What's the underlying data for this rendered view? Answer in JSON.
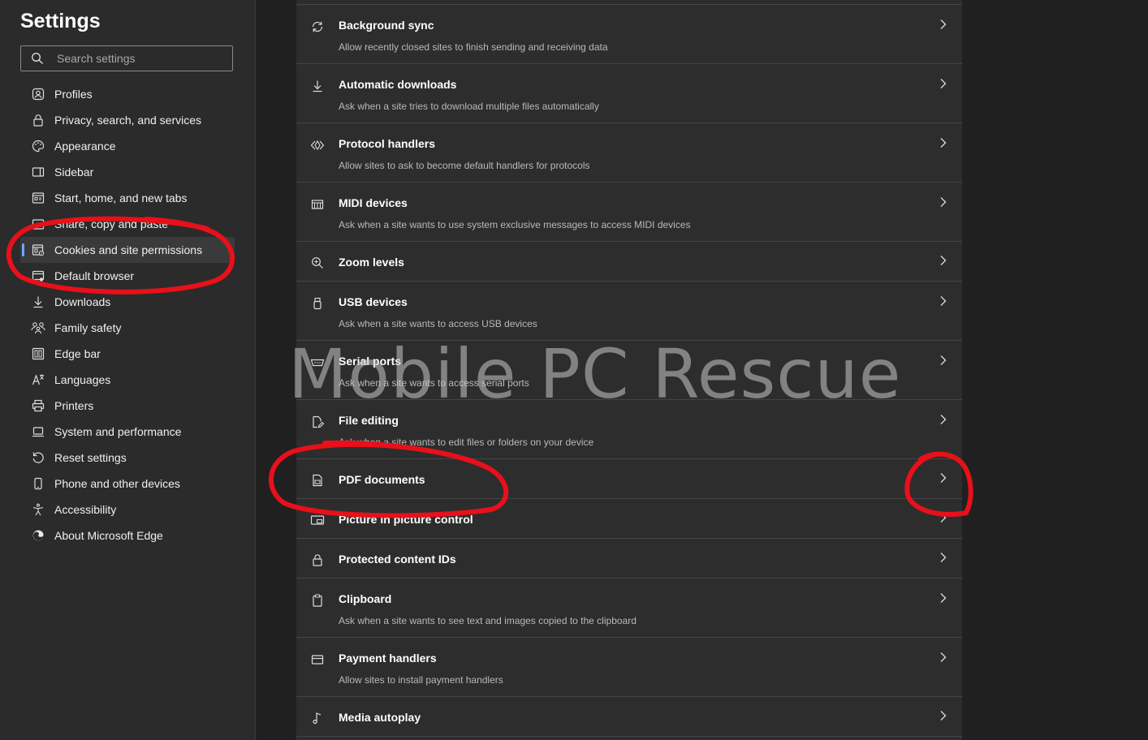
{
  "sidebar": {
    "title": "Settings",
    "search_placeholder": "Search settings",
    "items": [
      {
        "label": "Profiles",
        "icon": "profile-icon"
      },
      {
        "label": "Privacy, search, and services",
        "icon": "lock-icon"
      },
      {
        "label": "Appearance",
        "icon": "palette-icon"
      },
      {
        "label": "Sidebar",
        "icon": "sidebar-icon"
      },
      {
        "label": "Start, home, and new tabs",
        "icon": "home-tabs-icon"
      },
      {
        "label": "Share, copy and paste",
        "icon": "share-icon"
      },
      {
        "label": "Cookies and site permissions",
        "icon": "cookies-icon",
        "active": true
      },
      {
        "label": "Default browser",
        "icon": "browser-icon"
      },
      {
        "label": "Downloads",
        "icon": "download-icon"
      },
      {
        "label": "Family safety",
        "icon": "family-icon"
      },
      {
        "label": "Edge bar",
        "icon": "edge-bar-icon"
      },
      {
        "label": "Languages",
        "icon": "language-icon"
      },
      {
        "label": "Printers",
        "icon": "printer-icon"
      },
      {
        "label": "System and performance",
        "icon": "laptop-icon"
      },
      {
        "label": "Reset settings",
        "icon": "reset-icon"
      },
      {
        "label": "Phone and other devices",
        "icon": "phone-icon"
      },
      {
        "label": "Accessibility",
        "icon": "accessibility-icon"
      },
      {
        "label": "About Microsoft Edge",
        "icon": "edge-logo-icon"
      }
    ]
  },
  "permissions": [
    {
      "title": "Background sync",
      "subtitle": "Allow recently closed sites to finish sending and receiving data",
      "icon": "sync-icon"
    },
    {
      "title": "Automatic downloads",
      "subtitle": "Ask when a site tries to download multiple files automatically",
      "icon": "download-icon"
    },
    {
      "title": "Protocol handlers",
      "subtitle": "Allow sites to ask to become default handlers for protocols",
      "icon": "protocol-icon"
    },
    {
      "title": "MIDI devices",
      "subtitle": "Ask when a site wants to use system exclusive messages to access MIDI devices",
      "icon": "midi-icon"
    },
    {
      "title": "Zoom levels",
      "subtitle": "",
      "icon": "zoom-icon"
    },
    {
      "title": "USB devices",
      "subtitle": "Ask when a site wants to access USB devices",
      "icon": "usb-icon"
    },
    {
      "title": "Serial ports",
      "subtitle": "Ask when a site wants to access serial ports",
      "icon": "serial-port-icon"
    },
    {
      "title": "File editing",
      "subtitle": "Ask when a site wants to edit files or folders on your device",
      "icon": "file-edit-icon"
    },
    {
      "title": "PDF documents",
      "subtitle": "",
      "icon": "pdf-icon"
    },
    {
      "title": "Picture in picture control",
      "subtitle": "",
      "icon": "pip-icon"
    },
    {
      "title": "Protected content IDs",
      "subtitle": "",
      "icon": "lock-icon"
    },
    {
      "title": "Clipboard",
      "subtitle": "Ask when a site wants to see text and images copied to the clipboard",
      "icon": "clipboard-icon"
    },
    {
      "title": "Payment handlers",
      "subtitle": "Allow sites to install payment handlers",
      "icon": "card-icon"
    },
    {
      "title": "Media autoplay",
      "subtitle": "",
      "icon": "music-note-icon"
    }
  ],
  "watermark": "Mobile PC Rescue",
  "colors": {
    "accent": "#6ea8ff",
    "annotation": "#e8101a"
  }
}
